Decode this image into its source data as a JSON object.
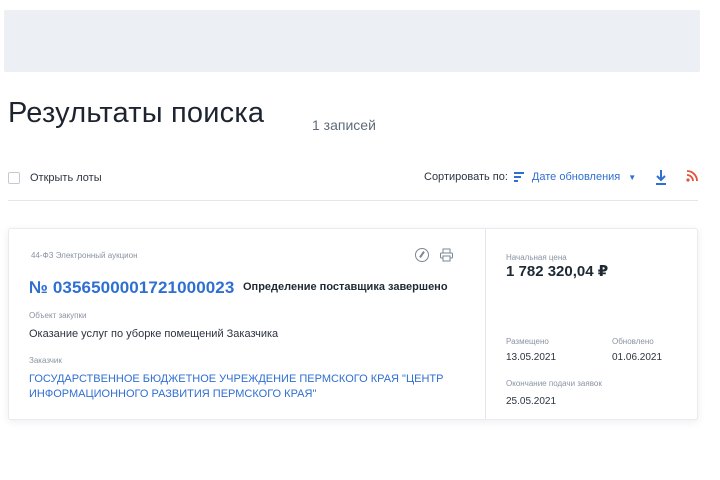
{
  "page": {
    "title": "Результаты поиска",
    "count": "1 записей"
  },
  "toolbar": {
    "open_lots": "Открыть лоты",
    "sort_label": "Сортировать по:",
    "sort_value": "Дате обновления",
    "sort_icon": "sort-lines-icon",
    "download_icon": "download-icon",
    "rss_icon": "rss-icon",
    "accent": "#2f6fd1",
    "rss_color": "#e0543a"
  },
  "result": {
    "law_type": "44-ФЗ Электронный аукцион",
    "number": "№ 0356500001721000023",
    "status": "Определение поставщика завершено",
    "object_label": "Объект закупки",
    "object_value": "Оказание услуг по уборке помещений Заказчика",
    "customer_label": "Заказчик",
    "customer_value": "ГОСУДАРСТВЕННОЕ БЮДЖЕТНОЕ УЧРЕЖДЕНИЕ ПЕРМСКОГО КРАЯ \"ЦЕНТР ИНФОРМАЦИОННОГО РАЗВИТИЯ ПЕРМСКОГО КРАЯ\"",
    "price_label": "Начальная цена",
    "price_value": "1 782 320,04 ₽",
    "posted_label": "Размещено",
    "posted_value": "13.05.2021",
    "updated_label": "Обновлено",
    "updated_value": "01.06.2021",
    "end_label": "Окончание подачи заявок",
    "end_value": "25.05.2021",
    "icons": [
      "compass-icon",
      "printer-icon"
    ]
  }
}
